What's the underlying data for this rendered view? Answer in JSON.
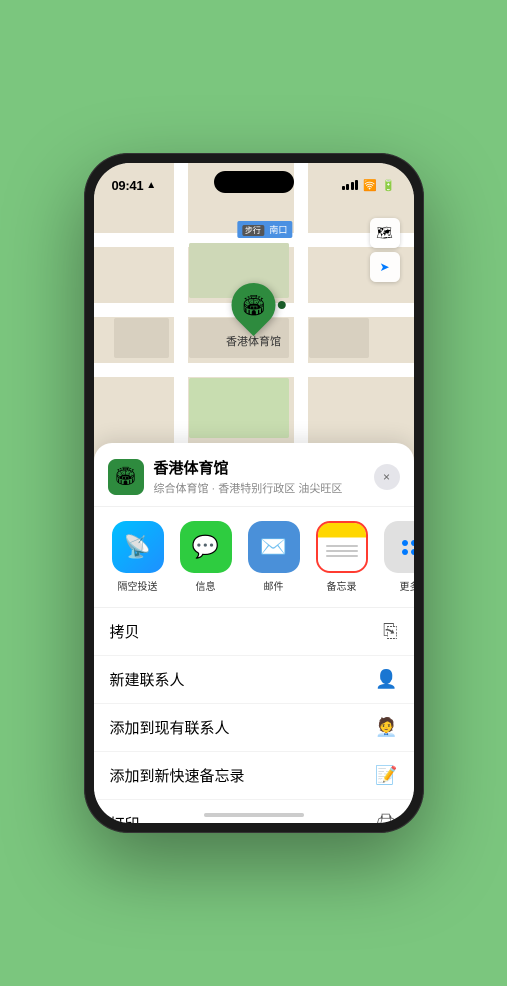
{
  "status": {
    "time": "09:41",
    "location_arrow": "▲"
  },
  "map": {
    "label": "南口",
    "label_prefix": "步行"
  },
  "map_controls": {
    "map_icon": "🗺",
    "location_icon": "➤"
  },
  "pin": {
    "label": "香港体育馆",
    "emoji": "🏟"
  },
  "sheet": {
    "venue_name": "香港体育馆",
    "venue_desc": "综合体育馆 · 香港特别行政区 油尖旺区",
    "close_label": "×"
  },
  "share_items": [
    {
      "id": "airdrop",
      "label": "隔空投送",
      "type": "airdrop"
    },
    {
      "id": "message",
      "label": "信息",
      "type": "message"
    },
    {
      "id": "mail",
      "label": "邮件",
      "type": "mail"
    },
    {
      "id": "notes",
      "label": "备忘录",
      "type": "notes"
    },
    {
      "id": "more",
      "label": "更多",
      "type": "more"
    }
  ],
  "action_items": [
    {
      "label": "拷贝",
      "icon": "copy"
    },
    {
      "label": "新建联系人",
      "icon": "person"
    },
    {
      "label": "添加到现有联系人",
      "icon": "person-add"
    },
    {
      "label": "添加到新快速备忘录",
      "icon": "note"
    },
    {
      "label": "打印",
      "icon": "print"
    }
  ]
}
